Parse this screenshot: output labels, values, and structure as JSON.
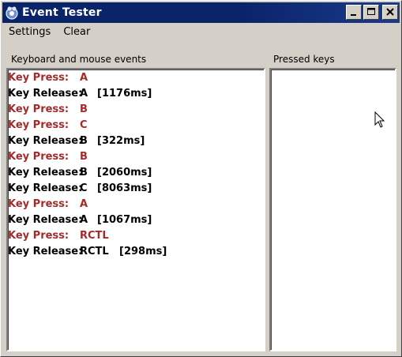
{
  "window": {
    "title": "Event Tester"
  },
  "menu": {
    "items": [
      "Settings",
      "Clear"
    ]
  },
  "events_panel": {
    "label": "Keyboard and mouse events",
    "rows": [
      {
        "type": "press",
        "kind": "Key Press:",
        "key": "A",
        "duration": ""
      },
      {
        "type": "release",
        "kind": "Key Release:",
        "key": "A",
        "duration": "[1176ms]"
      },
      {
        "type": "press",
        "kind": "Key Press:",
        "key": "B",
        "duration": ""
      },
      {
        "type": "press",
        "kind": "Key Press:",
        "key": "C",
        "duration": ""
      },
      {
        "type": "release",
        "kind": "Key Release:",
        "key": "B",
        "duration": "[322ms]"
      },
      {
        "type": "press",
        "kind": "Key Press:",
        "key": "B",
        "duration": ""
      },
      {
        "type": "release",
        "kind": "Key Release:",
        "key": "B",
        "duration": "[2060ms]"
      },
      {
        "type": "release",
        "kind": "Key Release:",
        "key": "C",
        "duration": "[8063ms]"
      },
      {
        "type": "press",
        "kind": "Key Press:",
        "key": "A",
        "duration": ""
      },
      {
        "type": "release",
        "kind": "Key Release:",
        "key": "A",
        "duration": "[1067ms]"
      },
      {
        "type": "press",
        "kind": "Key Press:",
        "key": "RCTL",
        "duration": ""
      },
      {
        "type": "release",
        "kind": "Key Release:",
        "key": "RCTL",
        "duration": "[298ms]"
      }
    ]
  },
  "pressed_panel": {
    "label": "Pressed keys"
  },
  "colors": {
    "press": "#a52a2a",
    "release": "#000000",
    "titlebar": "#0a246a"
  },
  "icons": {
    "app": "event-tester-app-icon",
    "minimize": "minimize-icon",
    "maximize": "maximize-icon",
    "close": "close-icon",
    "cursor": "mouse-pointer-icon"
  }
}
